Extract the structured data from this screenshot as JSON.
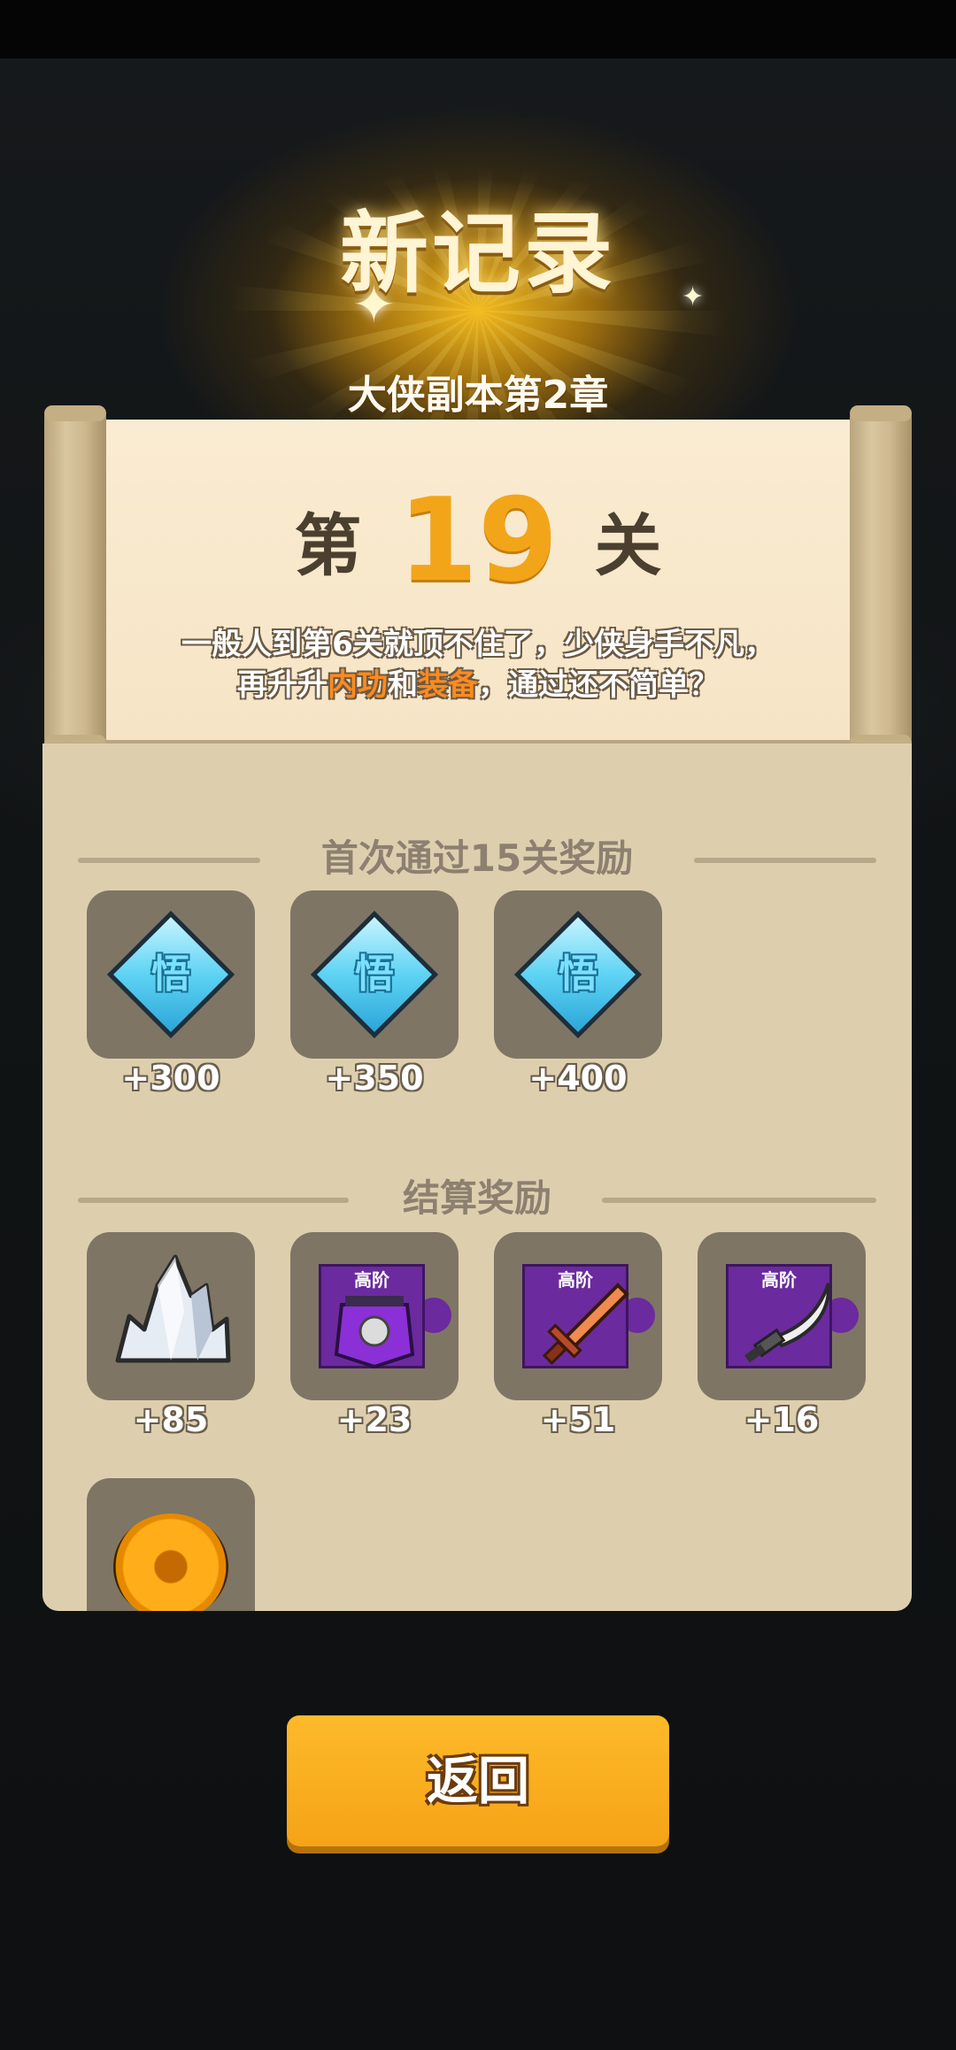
{
  "header": {
    "title": "新记录",
    "chapter": "大侠副本第2章"
  },
  "stage": {
    "prefix": "第",
    "number": "19",
    "suffix": "关",
    "desc_line1": "一般人到第6关就顶不住了，少侠身手不凡，",
    "desc_line2_a": "再升升",
    "desc_hl1": "内功",
    "desc_line2_b": "和",
    "desc_hl2": "装备",
    "desc_line2_c": "，通过还不简单？"
  },
  "first_clear": {
    "label": "首次通过15关奖励",
    "items": [
      {
        "icon": "wu-gem-icon",
        "glyph": "悟",
        "count": "+300"
      },
      {
        "icon": "wu-gem-icon",
        "glyph": "悟",
        "count": "+350"
      },
      {
        "icon": "wu-gem-icon",
        "glyph": "悟",
        "count": "+400"
      }
    ]
  },
  "settlement": {
    "label": "结算奖励",
    "items": [
      {
        "icon": "crystal-icon",
        "count": "+85"
      },
      {
        "icon": "armor-fragment-icon",
        "tier": "高阶",
        "count": "+23"
      },
      {
        "icon": "sword-fragment-icon",
        "tier": "高阶",
        "count": "+51"
      },
      {
        "icon": "saber-fragment-icon",
        "tier": "高阶",
        "count": "+16"
      },
      {
        "icon": "coin-icon"
      }
    ]
  },
  "actions": {
    "back_label": "返回"
  },
  "colors": {
    "accent_orange": "#f5a316",
    "highlight": "#ff8a1e",
    "paper": "#f6e4c5",
    "panel": "#ddcfae"
  }
}
